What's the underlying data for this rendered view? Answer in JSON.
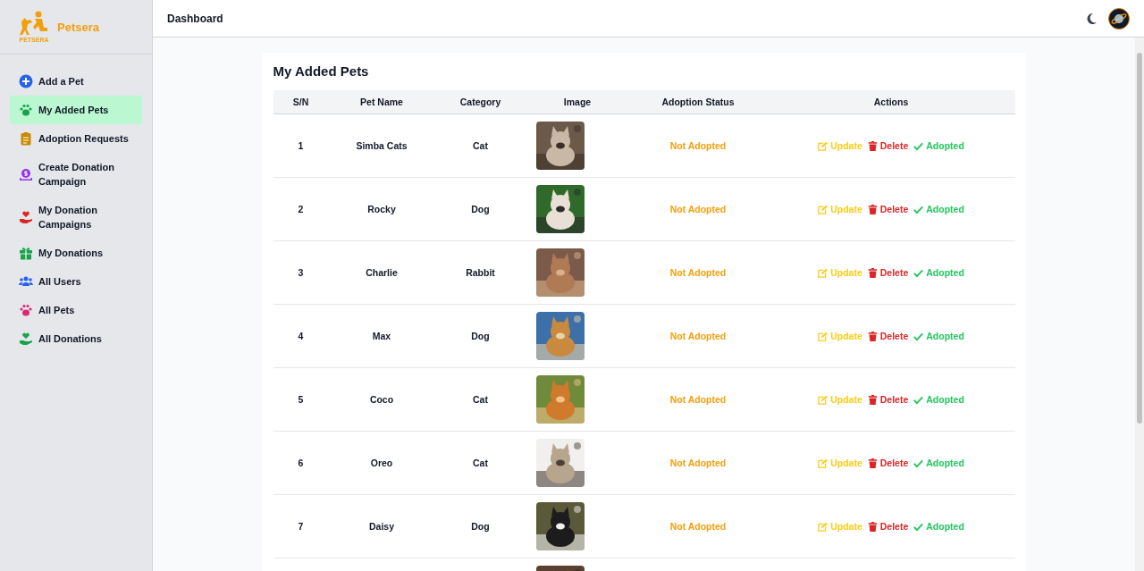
{
  "brand": {
    "name": "Petsera",
    "logo_caption": "PETSERA"
  },
  "sidebar": {
    "items": [
      {
        "label": "Add a Pet",
        "selected": false
      },
      {
        "label": "My Added Pets",
        "selected": true
      },
      {
        "label": "Adoption Requests",
        "selected": false
      },
      {
        "label": "Create Donation Campaign",
        "selected": false
      },
      {
        "label": "My Donation Campaigns",
        "selected": false
      },
      {
        "label": "My Donations",
        "selected": false
      },
      {
        "label": "All Users",
        "selected": false
      },
      {
        "label": "All Pets",
        "selected": false
      },
      {
        "label": "All Donations",
        "selected": false
      }
    ]
  },
  "header": {
    "title": "Dashboard"
  },
  "table": {
    "title": "My Added Pets",
    "columns": [
      "S/N",
      "Pet Name",
      "Category",
      "Image",
      "Adoption Status",
      "Actions"
    ],
    "rows": [
      {
        "sn": "1",
        "name": "Simba Cats",
        "category": "Cat",
        "image": {
          "kind": "picture"
        },
        "status": "Not Adopted",
        "actions": [
          {
            "kind": "update",
            "label": "Update"
          },
          {
            "kind": "delete",
            "label": "Delete"
          },
          {
            "kind": "adopted",
            "label": "Adopted"
          }
        ]
      },
      {
        "sn": "2",
        "name": "Rocky",
        "category": "Dog",
        "image": {
          "kind": "picture"
        },
        "status": "Not Adopted",
        "actions": [
          {
            "kind": "update",
            "label": "Update"
          },
          {
            "kind": "delete",
            "label": "Delete"
          },
          {
            "kind": "adopted",
            "label": "Adopted"
          }
        ]
      },
      {
        "sn": "3",
        "name": "Charlie",
        "category": "Rabbit",
        "image": {
          "kind": "picture"
        },
        "status": "Not Adopted",
        "actions": [
          {
            "kind": "update",
            "label": "Update"
          },
          {
            "kind": "delete",
            "label": "Delete"
          },
          {
            "kind": "adopted",
            "label": "Adopted"
          }
        ]
      },
      {
        "sn": "4",
        "name": "Max",
        "category": "Dog",
        "image": {
          "kind": "picture"
        },
        "status": "Not Adopted",
        "actions": [
          {
            "kind": "update",
            "label": "Update"
          },
          {
            "kind": "delete",
            "label": "Delete"
          },
          {
            "kind": "adopted",
            "label": "Adopted"
          }
        ]
      },
      {
        "sn": "5",
        "name": "Coco",
        "category": "Cat",
        "image": {
          "kind": "picture"
        },
        "status": "Not Adopted",
        "actions": [
          {
            "kind": "update",
            "label": "Update"
          },
          {
            "kind": "delete",
            "label": "Delete"
          },
          {
            "kind": "adopted",
            "label": "Adopted"
          }
        ]
      },
      {
        "sn": "6",
        "name": "Oreo",
        "category": "Cat",
        "image": {
          "kind": "picture"
        },
        "status": "Not Adopted",
        "actions": [
          {
            "kind": "update",
            "label": "Update"
          },
          {
            "kind": "delete",
            "label": "Delete"
          },
          {
            "kind": "adopted",
            "label": "Adopted"
          }
        ]
      },
      {
        "sn": "7",
        "name": "Daisy",
        "category": "Dog",
        "image": {
          "kind": "picture"
        },
        "status": "Not Adopted",
        "actions": [
          {
            "kind": "update",
            "label": "Update"
          },
          {
            "kind": "delete",
            "label": "Delete"
          },
          {
            "kind": "adopted",
            "label": "Adopted"
          }
        ]
      },
      {
        "image": {
          "kind": "picture"
        }
      }
    ]
  }
}
